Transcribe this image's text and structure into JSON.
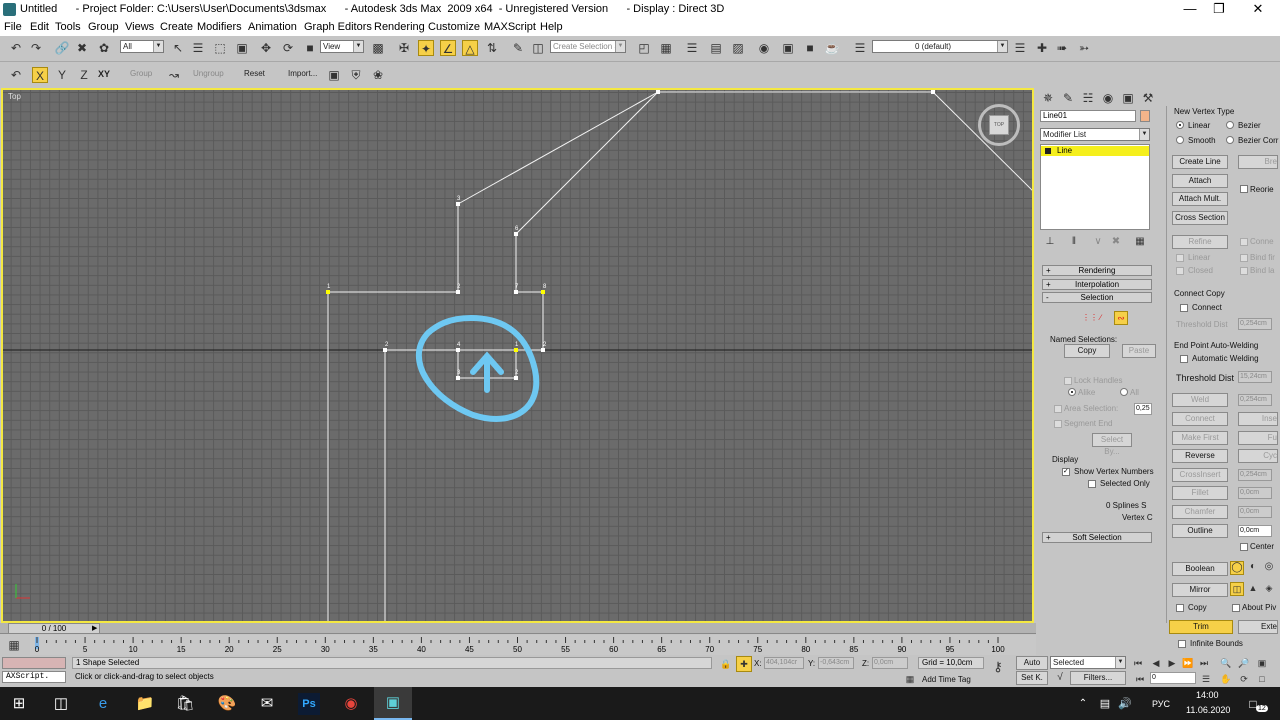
{
  "window": {
    "title": "Untitled      - Project Folder: C:\\Users\\User\\Documents\\3dsmax      - Autodesk 3ds Max  2009 x64  - Unregistered Version      - Display : Direct 3D",
    "controls": [
      "minimize",
      "restore",
      "close"
    ]
  },
  "menu": [
    "File",
    "Edit",
    "Tools",
    "Group",
    "Views",
    "Create",
    "Modifiers",
    "Animation",
    "Graph Editors",
    "Rendering",
    "Customize",
    "MAXScript",
    "Help"
  ],
  "toolbar": {
    "selection_filter": "All",
    "ref_coord": "View",
    "named_selection_placeholder": "Create Selection Se",
    "layer": "0 (default)"
  },
  "axis_toolbar": {
    "group": "Group",
    "xy_label": "XY",
    "ungroup": "Ungroup",
    "reset": "Reset",
    "import": "Import..."
  },
  "viewport": {
    "label": "Top",
    "viewcube_label": "TOP",
    "vertex_numbers": [
      "1",
      "2",
      "3",
      "4",
      "5",
      "6",
      "7",
      "8",
      "2",
      "4",
      "3",
      "3",
      "2",
      "1",
      "2",
      "3",
      "4",
      "5",
      "6"
    ]
  },
  "command_panel": {
    "object_name": "Line01",
    "modifier_list": "Modifier List",
    "stack_item": "Line",
    "rollouts": {
      "rendering": "Rendering",
      "interpolation": "Interpolation",
      "selection": "Selection",
      "soft_selection": "Soft Selection"
    },
    "named_selections": "Named Selections:",
    "copy": "Copy",
    "paste": "Paste",
    "lock_handles": "Lock Handles",
    "alike": "Alike",
    "all": "All",
    "area_selection": "Area Selection:",
    "area_value": "0,25",
    "segment_end": "Segment End",
    "select_by": "Select By...",
    "display": "Display",
    "show_vertex_numbers": "Show Vertex Numbers",
    "selected_only": "Selected Only",
    "splines_selected": "0 Splines S",
    "vertex_count": "Vertex C"
  },
  "geometry_panel": {
    "new_vertex_type": "New Vertex Type",
    "linear": "Linear",
    "bezier": "Bezier",
    "smooth": "Smooth",
    "bezier_corner": "Bezier Corr",
    "create_line": "Create Line",
    "break": "Bre",
    "attach": "Attach",
    "reorient": "Reorie",
    "attach_mult": "Attach Mult.",
    "cross_section": "Cross Section",
    "refine": "Refine",
    "connect_chk": "Conne",
    "linear_chk": "Linear",
    "bind_first": "Bind fir",
    "closed": "Closed",
    "bind_last": "Bind la",
    "connect_copy": "Connect Copy",
    "connect": "Connect",
    "threshold_dist": "Threshold Dist",
    "threshold_val1": "0,254cm",
    "end_point_welding": "End Point Auto-Welding",
    "automatic_welding": "Automatic Welding",
    "threshold_val2": "15,24cm",
    "weld": "Weld",
    "weld_val": "0,254cm",
    "connect_btn": "Connect",
    "insert": "Inse",
    "make_first": "Make First",
    "fuse": "Fu",
    "reverse": "Reverse",
    "cycle": "Cyc",
    "crossinsert": "CrossInsert",
    "crossinsert_val": "0,254cm",
    "fillet": "Fillet",
    "fillet_val": "0,0cm",
    "chamfer": "Chamfer",
    "chamfer_val": "0,0cm",
    "outline": "Outline",
    "outline_val": "0,0cm",
    "center": "Center",
    "boolean": "Boolean",
    "mirror": "Mirror",
    "copy": "Copy",
    "about_pivot": "About Piv",
    "trim": "Trim",
    "extend": "Exte",
    "infinite_bounds": "Infinite Bounds"
  },
  "timeline": {
    "frame_display": "0 / 100",
    "ticks": [
      "0",
      "5",
      "10",
      "15",
      "20",
      "25",
      "30",
      "35",
      "40",
      "45",
      "50",
      "55",
      "60",
      "65",
      "70",
      "75",
      "80",
      "85",
      "90",
      "95",
      "100"
    ]
  },
  "status": {
    "maxscript": "AXScript.",
    "shapes_selected": "1 Shape Selected",
    "prompt": "Click or click-and-drag to select objects",
    "x_label": "X:",
    "x_value": "404,104cr",
    "y_label": "Y:",
    "y_value": "-0,643cm",
    "z_label": "Z:",
    "z_value": "0,0cm",
    "grid": "Grid = 10,0cm",
    "add_time_tag": "Add Time Tag",
    "auto_key": "Auto",
    "set_key": "Set K.",
    "key_filter": "Selected",
    "filters": "Filters...",
    "current_frame": "0"
  },
  "taskbar": {
    "language": "РУС",
    "time": "14:00",
    "date": "11.06.2020",
    "notifications": "12"
  }
}
